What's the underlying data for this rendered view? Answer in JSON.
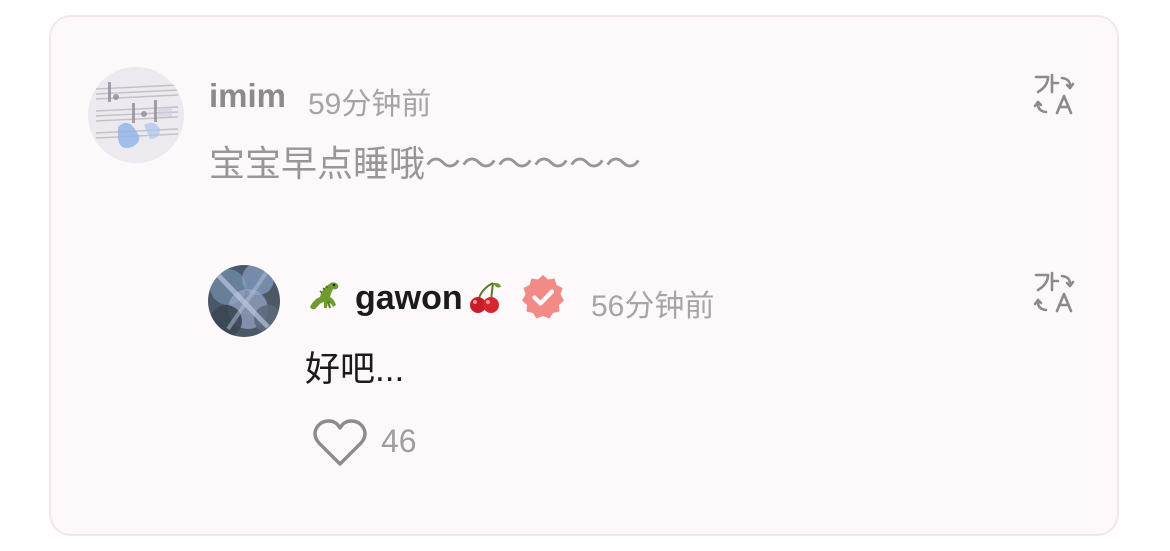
{
  "comment": {
    "username": "imim",
    "time": "59分钟前",
    "text": "宝宝早点睡哦～～～～～～",
    "avatar_icon": "sheet-music-photo-avatar"
  },
  "reply": {
    "username": "gawon",
    "prefix_emoji": "dinosaur-icon",
    "suffix_emoji": "cherry-icon",
    "badge": "verified-badge-icon",
    "time": "56分钟前",
    "text": "好吧...",
    "like_count": "46",
    "avatar_icon": "blurred-photo-avatar"
  },
  "colors": {
    "card_background": "#fdf8fa",
    "card_border": "#f5e4ea",
    "verified_badge": "#f28a85",
    "muted_text": "#9a9698"
  }
}
